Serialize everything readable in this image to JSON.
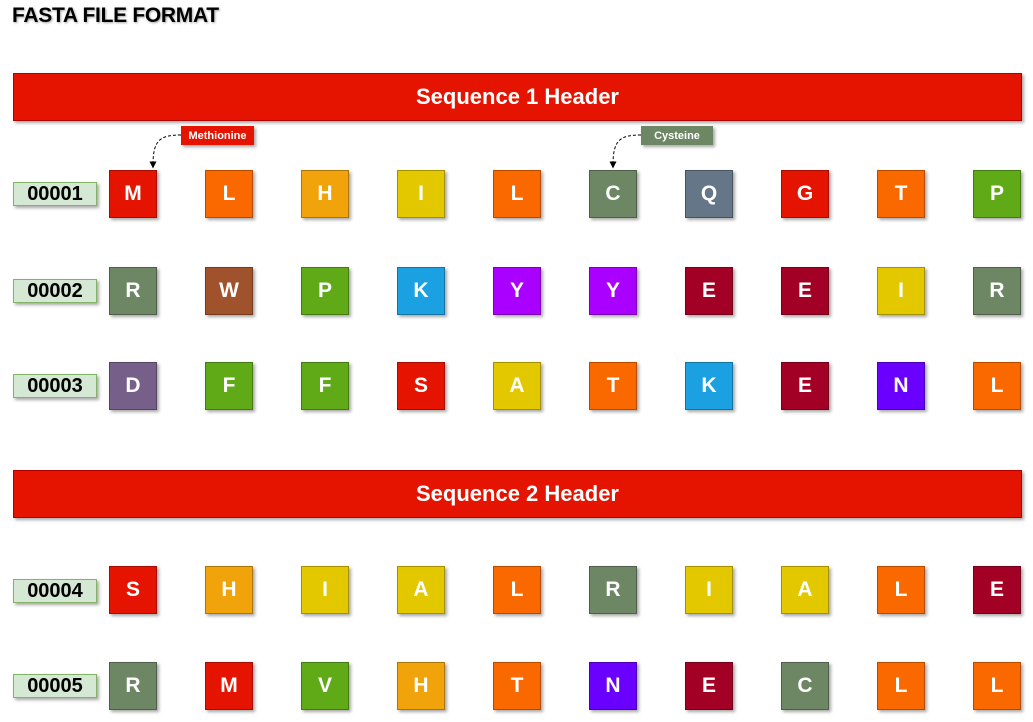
{
  "title": "FASTA FILE FORMAT",
  "colors": {
    "header": "#e51400",
    "row_label_fill": "#d5e8d4",
    "row_label_border": "#82b366",
    "methionine_tag": "#e51400",
    "cysteine_tag": "#6d8764",
    "residue_palette": {
      "red": "#e51400",
      "orange": "#fa6800",
      "amber": "#f0a30a",
      "yellow": "#e3c800",
      "olive": "#6d8764",
      "slate": "#647687",
      "green": "#60a917",
      "brown": "#a0522d",
      "blue": "#1ba1e2",
      "violet": "#aa00ff",
      "crimson": "#a20025",
      "mauve": "#76608a",
      "indigo": "#6a00ff"
    }
  },
  "annotations": [
    {
      "label": "Methionine",
      "color": "#e51400"
    },
    {
      "label": "Cysteine",
      "color": "#6d8764"
    }
  ],
  "sequences": [
    {
      "header": "Sequence 1 Header",
      "rows": [
        {
          "id": "00001",
          "residues": [
            {
              "letter": "M",
              "color": "#e51400"
            },
            {
              "letter": "L",
              "color": "#fa6800"
            },
            {
              "letter": "H",
              "color": "#f0a30a"
            },
            {
              "letter": "I",
              "color": "#e3c800"
            },
            {
              "letter": "L",
              "color": "#fa6800"
            },
            {
              "letter": "C",
              "color": "#6d8764"
            },
            {
              "letter": "Q",
              "color": "#647687"
            },
            {
              "letter": "G",
              "color": "#e51400"
            },
            {
              "letter": "T",
              "color": "#fa6800"
            },
            {
              "letter": "P",
              "color": "#60a917"
            }
          ]
        },
        {
          "id": "00002",
          "residues": [
            {
              "letter": "R",
              "color": "#6d8764"
            },
            {
              "letter": "W",
              "color": "#a0522d"
            },
            {
              "letter": "P",
              "color": "#60a917"
            },
            {
              "letter": "K",
              "color": "#1ba1e2"
            },
            {
              "letter": "Y",
              "color": "#aa00ff"
            },
            {
              "letter": "Y",
              "color": "#aa00ff"
            },
            {
              "letter": "E",
              "color": "#a20025"
            },
            {
              "letter": "E",
              "color": "#a20025"
            },
            {
              "letter": "I",
              "color": "#e3c800"
            },
            {
              "letter": "R",
              "color": "#6d8764"
            }
          ]
        },
        {
          "id": "00003",
          "residues": [
            {
              "letter": "D",
              "color": "#76608a"
            },
            {
              "letter": "F",
              "color": "#60a917"
            },
            {
              "letter": "F",
              "color": "#60a917"
            },
            {
              "letter": "S",
              "color": "#e51400"
            },
            {
              "letter": "A",
              "color": "#e3c800"
            },
            {
              "letter": "T",
              "color": "#fa6800"
            },
            {
              "letter": "K",
              "color": "#1ba1e2"
            },
            {
              "letter": "E",
              "color": "#a20025"
            },
            {
              "letter": "N",
              "color": "#6a00ff"
            },
            {
              "letter": "L",
              "color": "#fa6800"
            }
          ]
        }
      ]
    },
    {
      "header": "Sequence 2 Header",
      "rows": [
        {
          "id": "00004",
          "residues": [
            {
              "letter": "S",
              "color": "#e51400"
            },
            {
              "letter": "H",
              "color": "#f0a30a"
            },
            {
              "letter": "I",
              "color": "#e3c800"
            },
            {
              "letter": "A",
              "color": "#e3c800"
            },
            {
              "letter": "L",
              "color": "#fa6800"
            },
            {
              "letter": "R",
              "color": "#6d8764"
            },
            {
              "letter": "I",
              "color": "#e3c800"
            },
            {
              "letter": "A",
              "color": "#e3c800"
            },
            {
              "letter": "L",
              "color": "#fa6800"
            },
            {
              "letter": "E",
              "color": "#a20025"
            }
          ]
        },
        {
          "id": "00005",
          "residues": [
            {
              "letter": "R",
              "color": "#6d8764"
            },
            {
              "letter": "M",
              "color": "#e51400"
            },
            {
              "letter": "V",
              "color": "#60a917"
            },
            {
              "letter": "H",
              "color": "#f0a30a"
            },
            {
              "letter": "T",
              "color": "#fa6800"
            },
            {
              "letter": "N",
              "color": "#6a00ff"
            },
            {
              "letter": "E",
              "color": "#a20025"
            },
            {
              "letter": "C",
              "color": "#6d8764"
            },
            {
              "letter": "L",
              "color": "#fa6800"
            },
            {
              "letter": "L",
              "color": "#fa6800"
            }
          ]
        }
      ]
    }
  ]
}
